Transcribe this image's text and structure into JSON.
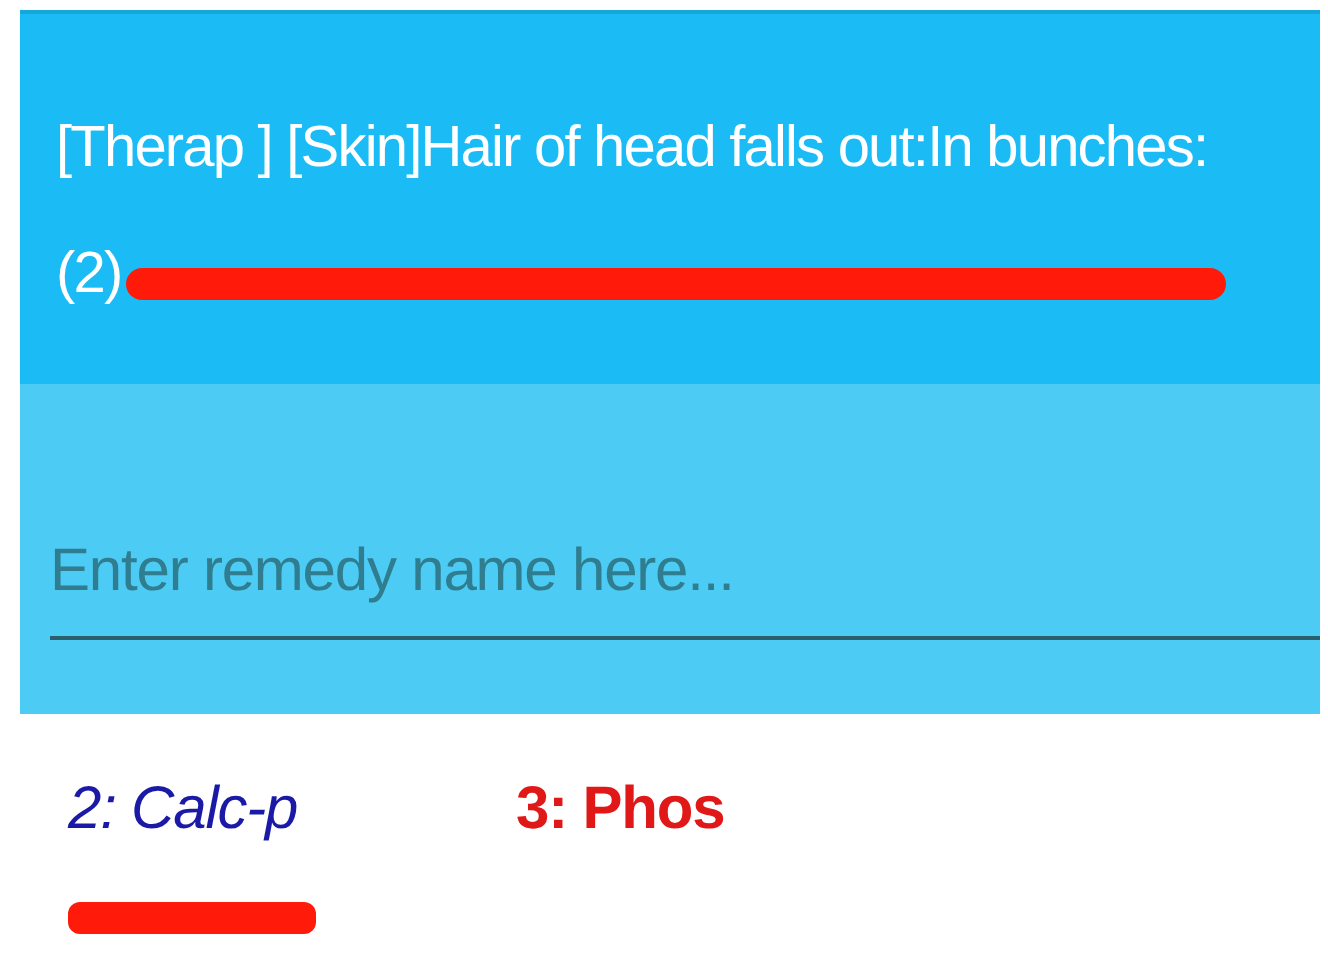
{
  "header": {
    "title": "[Therap ] [Skin]Hair of head falls out:In bunches: (2)",
    "highlighted": true
  },
  "search": {
    "placeholder": "Enter remedy name here..."
  },
  "remedies": [
    {
      "label": "2: Calc-p",
      "kind": "italic",
      "color": "#1a1aa6",
      "selected": true
    },
    {
      "label": "3: Phos",
      "kind": "bold",
      "color": "#e01818",
      "selected": false
    }
  ]
}
